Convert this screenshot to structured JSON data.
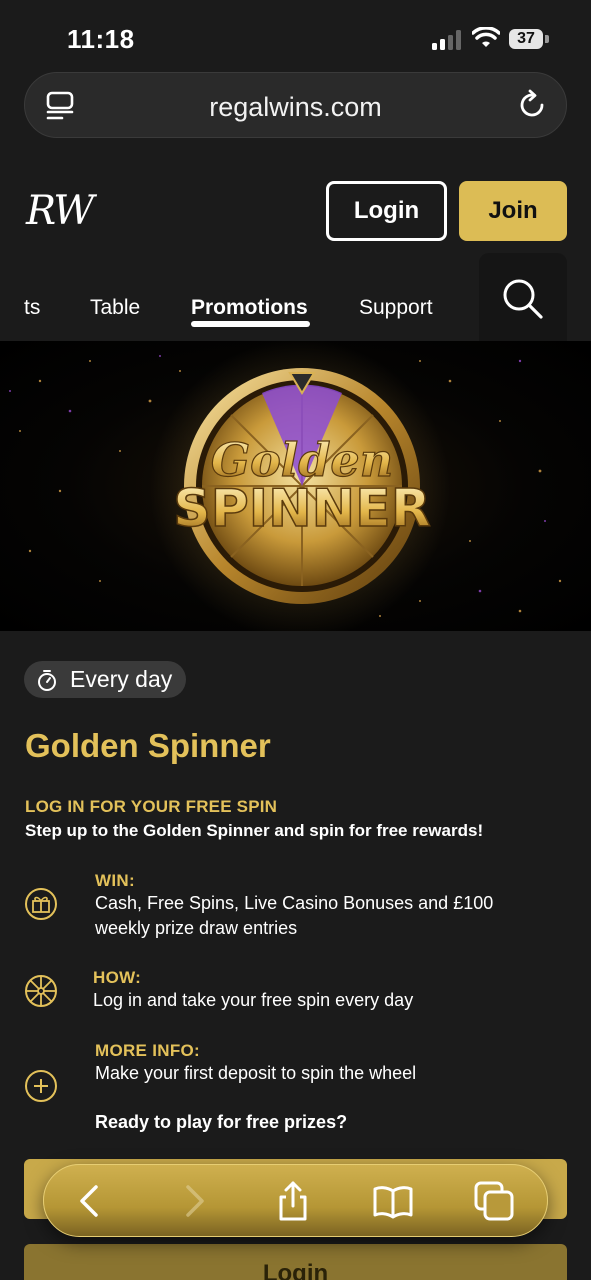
{
  "status_bar": {
    "time": "11:18",
    "battery": "37"
  },
  "browser": {
    "url": "regalwins.com"
  },
  "site": {
    "logo": "RW",
    "login_label": "Login",
    "join_label": "Join",
    "nav": [
      "ts",
      "Table",
      "Promotions",
      "Support"
    ],
    "active_nav": "Promotions"
  },
  "banner": {
    "line1": "Golden",
    "line2": "SPINNER"
  },
  "promo": {
    "badge": "Every day",
    "title": "Golden Spinner",
    "subtitle": "LOG IN FOR YOUR FREE SPIN",
    "tagline": "Step up to the Golden Spinner and spin for free rewards!",
    "rows": [
      {
        "heading": "WIN:",
        "text": "Cash, Free Spins, Live Casino Bonuses and £100 weekly prize draw entries",
        "icon": "gift-icon"
      },
      {
        "heading": "HOW:",
        "text": "Log in and take your free spin every day",
        "icon": "wheel-icon"
      },
      {
        "heading": "MORE INFO:",
        "text": "Make your first deposit to spin the wheel",
        "icon": "plus-circle-icon"
      }
    ],
    "cta_question": "Ready to play for free prizes?",
    "login_button": "Login"
  },
  "colors": {
    "gold": "#e3c15a",
    "join_bg": "#dcbc55",
    "background": "#1b1b1b"
  }
}
